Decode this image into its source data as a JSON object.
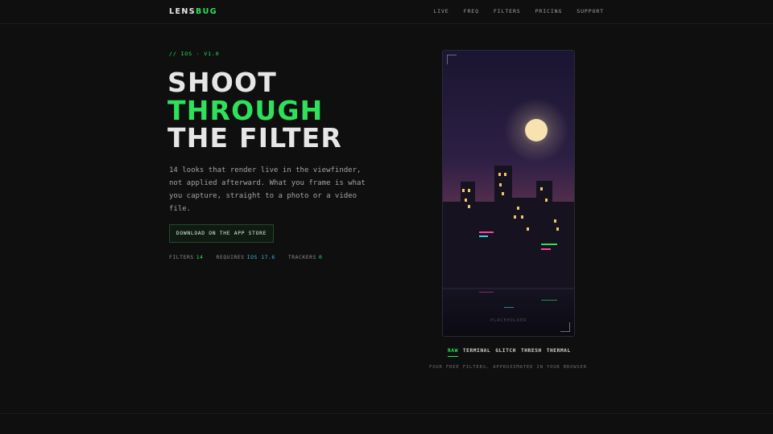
{
  "nav": {
    "brand_main": "LENS",
    "brand_accent": "BUG",
    "links": [
      "LIVE",
      "FREQ",
      "FILTERS",
      "PRICING",
      "SUPPORT"
    ]
  },
  "hero": {
    "eyebrow": "// IOS · V1.0",
    "headline": [
      "SHOOT",
      "THROUGH",
      "THE FILTER"
    ],
    "description": "14 looks that render live in the viewfinder, not applied afterward. What you frame is what you capture, straight to a photo or a video file.",
    "cta_label": "DOWNLOAD ON THE APP STORE",
    "meta": [
      {
        "label": "FILTERS",
        "value": "14"
      },
      {
        "label": "REQUIRES",
        "value": "IOS 17.6"
      },
      {
        "label": "TRACKERS",
        "value": "0"
      }
    ]
  },
  "preview": {
    "placeholder": "PLACEHOLDER",
    "filters": [
      "RAW",
      "TERMINAL",
      "GLITCH",
      "THRESH",
      "THERMAL"
    ],
    "active_filter": "RAW",
    "caption": "FOUR FREE FILTERS, APPROXIMATED IN YOUR BROWSER"
  },
  "colors": {
    "background": "#0f0f0f",
    "accent_green": "#2fe05a",
    "accent_cyan": "#3fb8d8"
  }
}
